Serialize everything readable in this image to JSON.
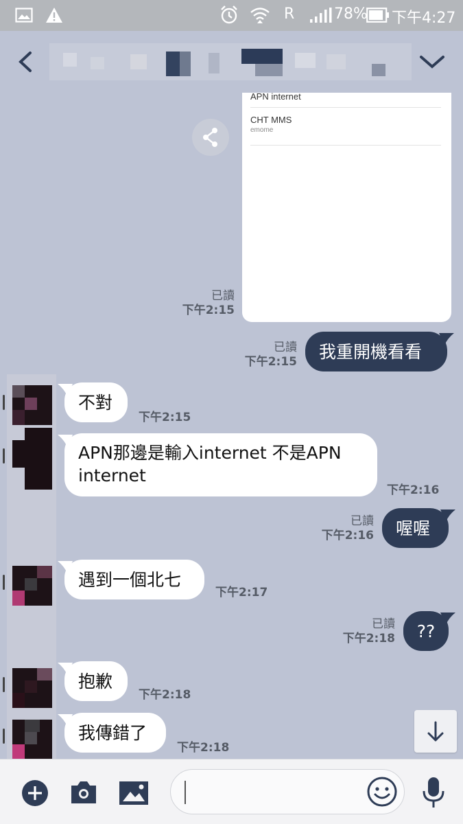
{
  "status_bar": {
    "carrier_flag": "R",
    "battery": "78%",
    "time": "下午4:27"
  },
  "screenshot": {
    "apn_rows": [
      {
        "name": "APN internet",
        "sub": ""
      },
      {
        "name": "CHT MMS",
        "sub": "emome"
      }
    ],
    "read_label": "已讀",
    "time": "下午2:15"
  },
  "messages": [
    {
      "id": "m1",
      "direction": "out",
      "text": "我重開機看看",
      "read": "已讀",
      "time": "下午2:15"
    },
    {
      "id": "m2",
      "direction": "in",
      "text": "不對",
      "time": "下午2:15"
    },
    {
      "id": "m3",
      "direction": "in",
      "line1": "APN那邊是輸入internet 不是APN",
      "line2": "internet",
      "time": "下午2:16"
    },
    {
      "id": "m4",
      "direction": "out",
      "text": "喔喔",
      "read": "已讀",
      "time": "下午2:16"
    },
    {
      "id": "m5",
      "direction": "in",
      "text": "遇到一個北七",
      "time": "下午2:17"
    },
    {
      "id": "m6",
      "direction": "out",
      "text": "??",
      "read": "已讀",
      "time": "下午2:18"
    },
    {
      "id": "m7",
      "direction": "in",
      "text": "抱歉",
      "time": "下午2:18"
    },
    {
      "id": "m8",
      "direction": "in",
      "text": "我傳錯了",
      "time": "下午2:18"
    }
  ],
  "input": {
    "placeholder": "",
    "value": ""
  },
  "icons": {
    "back": "chevron-left-icon",
    "expand": "chevron-down-icon",
    "share": "share-icon",
    "scroll": "arrow-down-icon",
    "add": "plus-circle-icon",
    "camera": "camera-icon",
    "gallery": "image-icon",
    "emoji": "smiley-icon",
    "mic": "microphone-icon"
  },
  "colors": {
    "background": "#bdc3d4",
    "outgoing_bubble": "#2e3c56",
    "incoming_bubble": "#ffffff",
    "status_bar": "#b4b7bb"
  }
}
